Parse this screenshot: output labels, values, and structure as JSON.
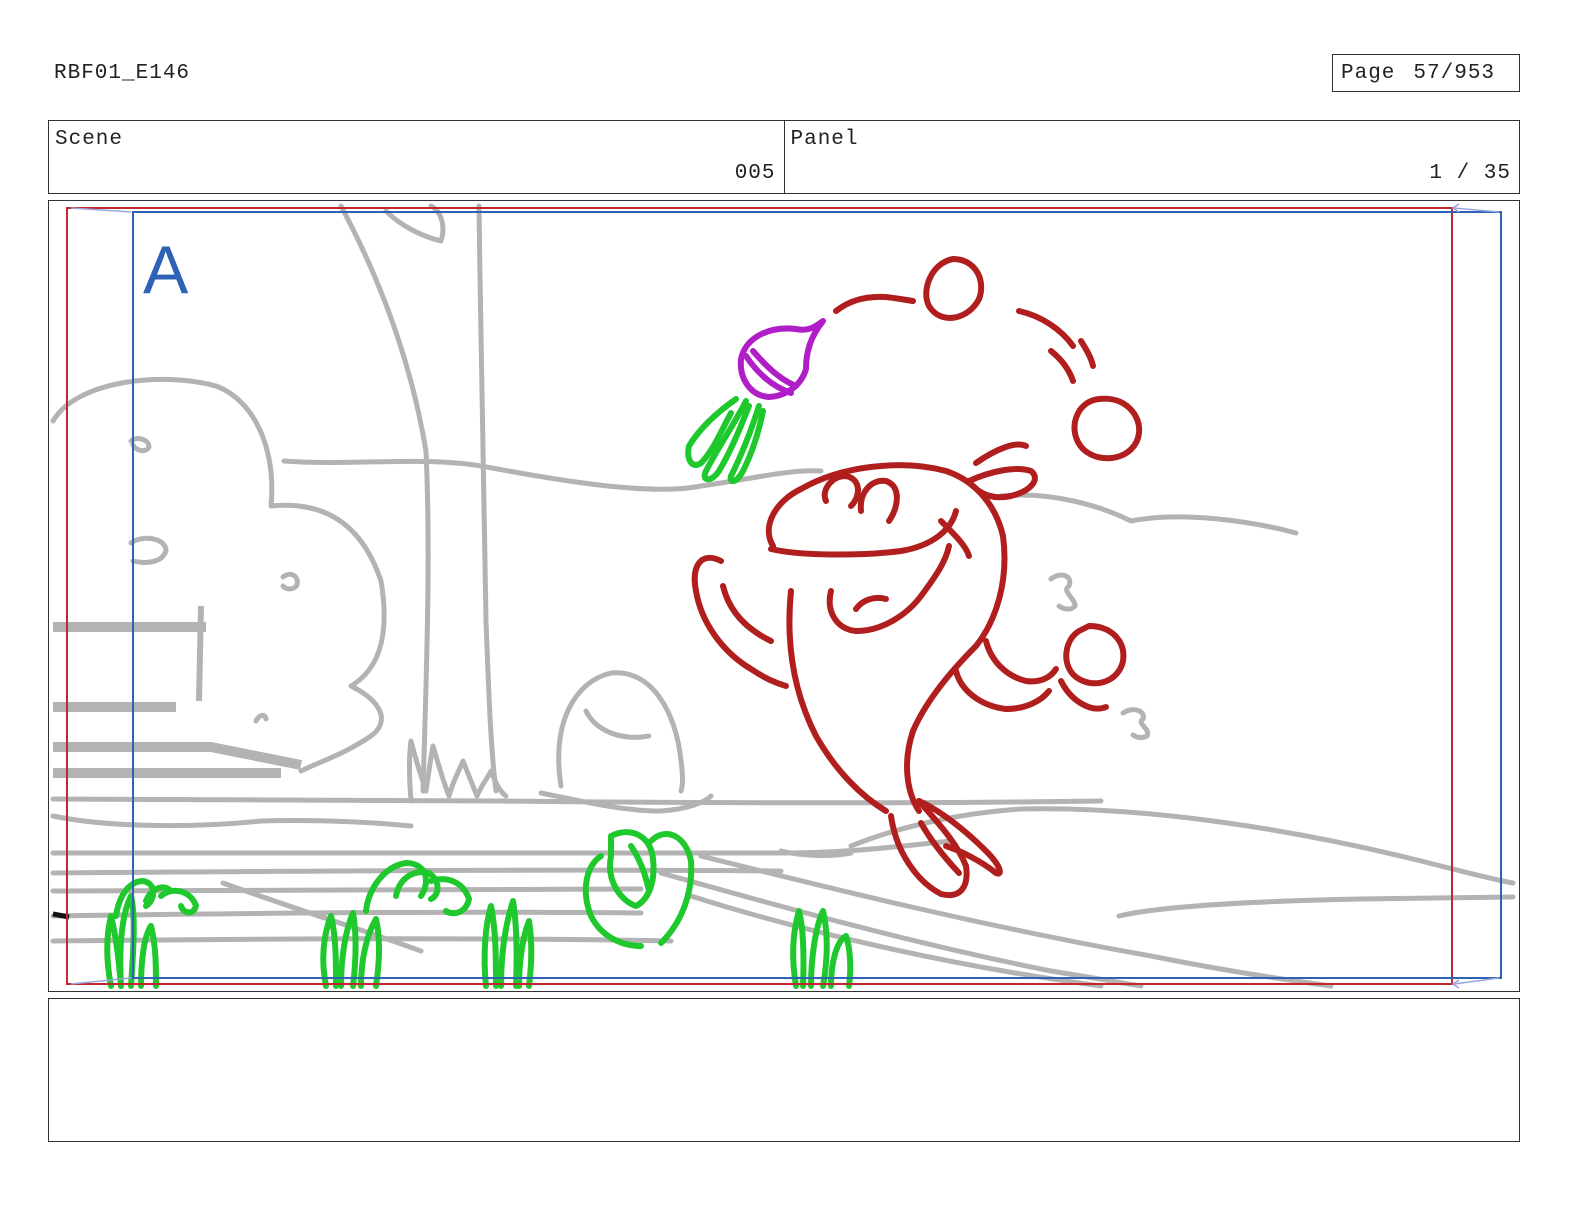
{
  "header": {
    "doc_id": "RBF01_E146",
    "page_label": "Page",
    "page_value": "57/953"
  },
  "info": {
    "scene_label": "Scene",
    "scene_value": "005",
    "panel_label": "Panel",
    "panel_value": "1 / 35"
  },
  "panel": {
    "letter": "A",
    "colors": {
      "background_sketch": "#b3b3b3",
      "character": "#b01e1e",
      "plants": "#1ec82d",
      "flower": "#b01ec8",
      "safe_frame": "#c0282d",
      "camera_frame": "#2e62b5"
    }
  },
  "notes": {
    "text": ""
  }
}
